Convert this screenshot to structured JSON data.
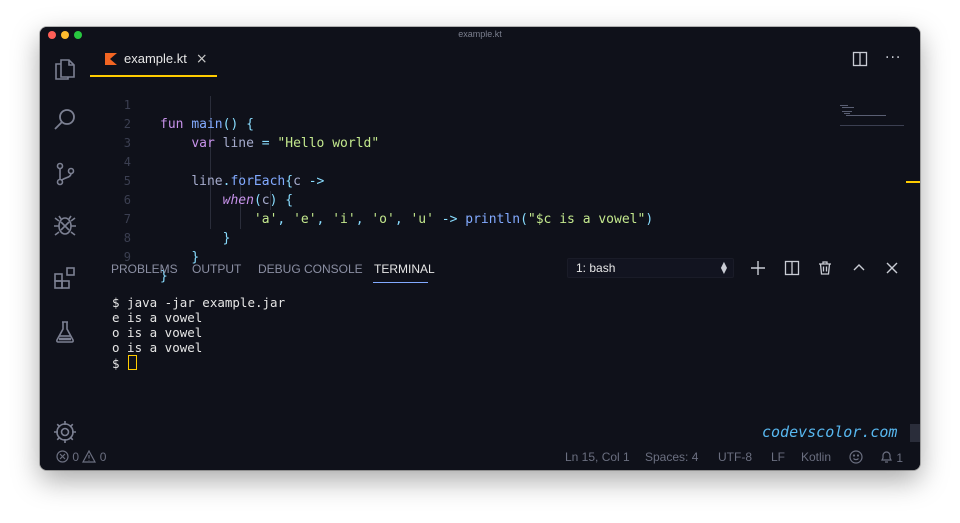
{
  "window": {
    "title": "example.kt"
  },
  "activity_bar": {
    "items": [
      "explorer-icon",
      "search-icon",
      "source-control-icon",
      "debug-icon",
      "extensions-icon",
      "flask-icon"
    ],
    "settings": "gear-icon"
  },
  "tab": {
    "label": "example.kt",
    "close": "×",
    "icon": "kotlin-icon"
  },
  "editor": {
    "line_numbers": [
      "1",
      "2",
      "3",
      "4",
      "5",
      "6",
      "7",
      "8",
      "9"
    ]
  },
  "panel": {
    "tabs": [
      "PROBLEMS",
      "OUTPUT",
      "DEBUG CONSOLE",
      "TERMINAL"
    ],
    "active_tab": "TERMINAL",
    "terminal_select": "1: bash",
    "terminal_lines": [
      "$ java -jar example.jar",
      "e is a vowel",
      "o is a vowel",
      "o is a vowel",
      "$ "
    ],
    "watermark": "codevscolor.com"
  },
  "status_bar": {
    "errors": "0",
    "warnings": "0",
    "position": "Ln 15, Col 1",
    "spaces": "Spaces: 4",
    "encoding": "UTF-8",
    "eol": "LF",
    "language": "Kotlin",
    "notifications": "1"
  },
  "colors": {
    "background": "#0f111a",
    "accent": "#ffcc00",
    "keyword": "#c792ea",
    "function": "#82aaff",
    "string": "#c3e88d",
    "variable": "#a6accd",
    "operator": "#89ddff",
    "watermark": "#58b8f0"
  }
}
